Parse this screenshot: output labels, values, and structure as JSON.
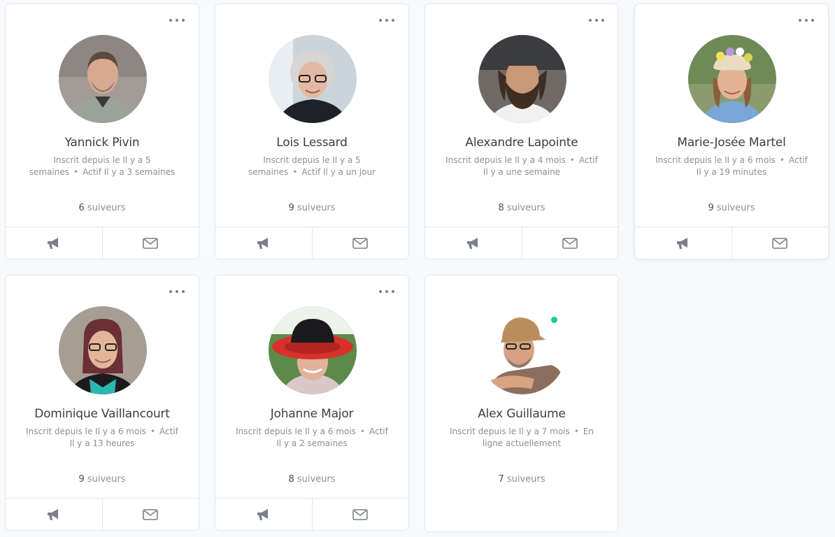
{
  "members": [
    {
      "name": "Yannick Pivin",
      "meta": [
        "Inscrit depuis le Il y a 5 semaines",
        "Actif Il y a 3 semaines"
      ],
      "followers_count": "6",
      "followers_label": "suiveurs",
      "has_more_menu": true,
      "has_actions": true,
      "online": false
    },
    {
      "name": "Lois Lessard",
      "meta": [
        "Inscrit depuis le Il y a 5 semaines",
        "Actif Il y a un jour"
      ],
      "followers_count": "9",
      "followers_label": "suiveurs",
      "has_more_menu": true,
      "has_actions": true,
      "online": false
    },
    {
      "name": "Alexandre Lapointe",
      "meta": [
        "Inscrit depuis le Il y a 4 mois",
        "Actif Il y a une semaine"
      ],
      "followers_count": "8",
      "followers_label": "suiveurs",
      "has_more_menu": true,
      "has_actions": true,
      "online": false
    },
    {
      "name": "Marie-Josée Martel",
      "meta": [
        "Inscrit depuis le Il y a 6 mois",
        "Actif Il y a 19 minutes"
      ],
      "followers_count": "9",
      "followers_label": "suiveurs",
      "has_more_menu": true,
      "has_actions": true,
      "online": false
    },
    {
      "name": "Dominique Vaillancourt",
      "meta": [
        "Inscrit depuis le Il y a 6 mois",
        "Actif Il y a 13 heures"
      ],
      "followers_count": "9",
      "followers_label": "suiveurs",
      "has_more_menu": true,
      "has_actions": true,
      "online": false
    },
    {
      "name": "Johanne Major",
      "meta": [
        "Inscrit depuis le Il y a 6 mois",
        "Actif Il y a 2 semaines"
      ],
      "followers_count": "8",
      "followers_label": "suiveurs",
      "has_more_menu": true,
      "has_actions": true,
      "online": false
    },
    {
      "name": "Alex Guillaume",
      "meta": [
        "Inscrit depuis le Il y a 7 mois",
        "En ligne actuellement"
      ],
      "followers_count": "7",
      "followers_label": "suiveurs",
      "has_more_menu": false,
      "has_actions": false,
      "online": true
    }
  ],
  "icons": {
    "more": "more-options-icon",
    "follow": "megaphone-icon",
    "message": "envelope-icon"
  },
  "colors": {
    "online": "#1cc88a",
    "icon": "#7b7f88"
  }
}
